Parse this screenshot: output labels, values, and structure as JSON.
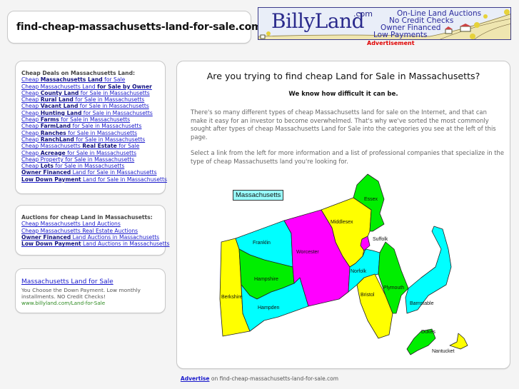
{
  "header": {
    "site_title": "find-cheap-massachusetts-land-for-sale.com"
  },
  "banner": {
    "logo": "BillyLand",
    "logo_suffix": ".com",
    "lines": [
      "On-Line Land Auctions",
      "No Credit Checks",
      "Owner Financed",
      "Low Payments"
    ],
    "ad_label": "Advertisement"
  },
  "deals": {
    "heading": "Cheap Deals on Massachusetts Land:",
    "links": [
      {
        "pre": "Cheap ",
        "bold": "Massachusetts Land",
        "post": " for Sale"
      },
      {
        "pre": "Cheap Massachusetts Land ",
        "bold": "for Sale by Owner",
        "post": ""
      },
      {
        "pre": "Cheap ",
        "bold": "County Land",
        "post": " for Sale in Massachusetts"
      },
      {
        "pre": "Cheap ",
        "bold": "Rural Land",
        "post": " for Sale in Massachusetts"
      },
      {
        "pre": "Cheap ",
        "bold": "Vacant Land",
        "post": " for Sale in Massachusetts"
      },
      {
        "pre": "Cheap ",
        "bold": "Hunting Land",
        "post": " for Sale in Massachusetts"
      },
      {
        "pre": "Cheap ",
        "bold": "Farms",
        "post": " for Sale in Massachusetts"
      },
      {
        "pre": "Cheap ",
        "bold": "FarmLand",
        "post": " for Sale in Massachusetts"
      },
      {
        "pre": "Cheap ",
        "bold": "Ranches",
        "post": " for Sale in Massachusetts"
      },
      {
        "pre": "Cheap ",
        "bold": "RanchLand",
        "post": " for Sale in Massachusetts"
      },
      {
        "pre": "Cheap Massachusetts ",
        "bold": "Real Estate",
        "post": " for Sale"
      },
      {
        "pre": "Cheap ",
        "bold": "Acreage",
        "post": " for Sale in Massachusetts"
      },
      {
        "pre": "Cheap Property for Sale in Massachusetts",
        "bold": "",
        "post": ""
      },
      {
        "pre": "Cheap ",
        "bold": "Lots",
        "post": " for Sale in Massachusetts"
      },
      {
        "pre": "",
        "bold": "Owner Financed",
        "post": " Land for Sale in Massachusetts"
      },
      {
        "pre": "",
        "bold": "Low Down Payment",
        "post": " Land for Sale in Massachusetts"
      }
    ]
  },
  "auctions": {
    "heading": "Auctions for cheap Land in Massachusetts:",
    "links": [
      {
        "pre": "Cheap Massachusetts Land Auctions",
        "bold": "",
        "post": ""
      },
      {
        "pre": "Cheap Massachusetts Real Estate Auctions",
        "bold": "",
        "post": ""
      },
      {
        "pre": "",
        "bold": "Owner Financed",
        "post": " Land Auctions in Massachusetts"
      },
      {
        "pre": "",
        "bold": "Low Down Payment",
        "post": " Land Auctions in Massachusetts"
      }
    ]
  },
  "text_ad": {
    "title": "Massachusetts Land for Sale",
    "description": "You Choose the Down Payment. Low monthly installments. NO Credit Checks!",
    "url": "www.billyland.com/Land-for-Sale"
  },
  "main": {
    "heading": "Are you trying to find cheap Land for Sale in Massachusetts?",
    "subheading": "We know how difficult it can be.",
    "paragraph1": "There's so many different types of cheap Massachusetts land for sale on the Internet, and that can make it easy for an investor to become overwhelmed. That's why we've sorted the most commonly sought after types of cheap Massachusetts Land for Sale into the categories you see at the left of this page.",
    "paragraph2": "Select a link from the left for more information and a list of professional companies that specialize in the type of cheap Massachusetts land you're looking for.",
    "map": {
      "title": "Massachusetts",
      "colors": {
        "yellow": "#ffff00",
        "green": "#00ee00",
        "cyan": "#00ffff",
        "magenta": "#ff00ff"
      },
      "counties": [
        "Essex",
        "Middlesex",
        "Suffolk",
        "Franklin",
        "Worcester",
        "Norfolk",
        "Hampshire",
        "Berkshire",
        "Hampden",
        "Plymouth",
        "Bristol",
        "Barnstable",
        "Dukes",
        "Nantucket"
      ]
    }
  },
  "footer": {
    "link": "Advertise",
    "text": " on find-cheap-massachusetts-land-for-sale.com"
  }
}
